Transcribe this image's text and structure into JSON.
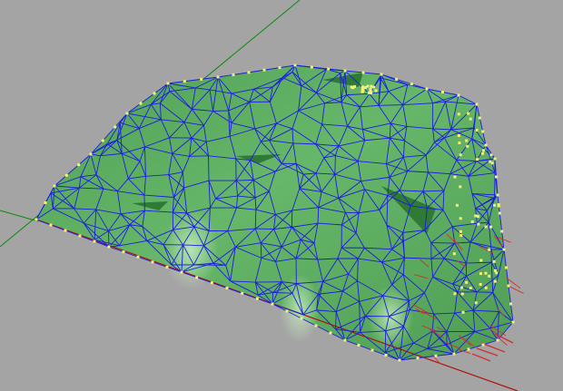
{
  "viewport": {
    "background_color": "#a4a4a4",
    "projection": "perspective",
    "display_mode": "shaded-with-wireframe"
  },
  "axes": {
    "x_axis_color": "#b01010",
    "y_axis_color": "#0a8a0a"
  },
  "mesh": {
    "surface_color": "#5fae63",
    "surface_shadow_color": "#3f8f45",
    "highlight_color": "#b8e3b2",
    "edge_color": "#1c1ce0",
    "vertex_color": "#f2f27a",
    "selected_edge_color": "#d03030"
  }
}
